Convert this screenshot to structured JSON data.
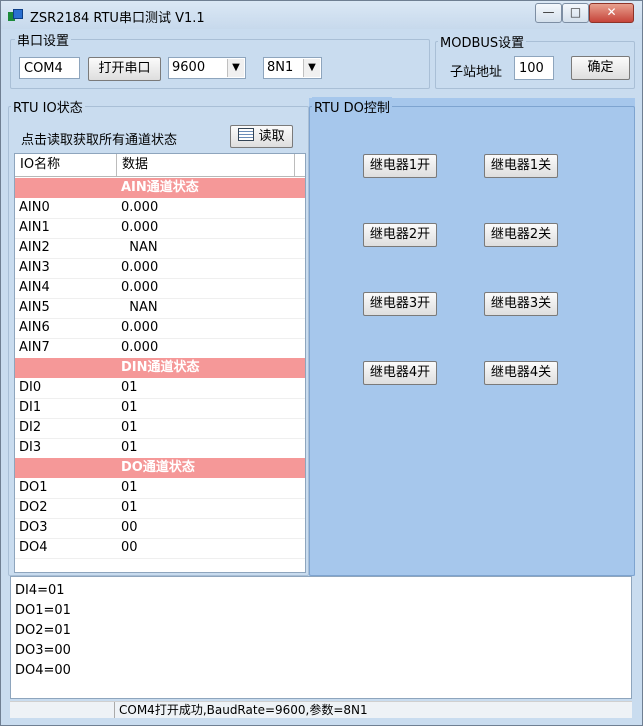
{
  "window": {
    "title": "ZSR2184 RTU串口测试 V1.1",
    "min_label": "—",
    "max_label": "□",
    "close_label": "✕"
  },
  "serial": {
    "group_title": "串口设置",
    "port": "COM4",
    "open_label": "打开串口",
    "baud": "9600",
    "param": "8N1"
  },
  "modbus": {
    "group_title": "MODBUS设置",
    "addr_label": "子站地址",
    "addr_value": "100",
    "confirm_label": "确定"
  },
  "io": {
    "group_title": "RTU IO状态",
    "hint": "点击读取获取所有通道状态",
    "read_label": "读取",
    "col_name": "IO名称",
    "col_data": "数据",
    "rows": [
      {
        "name": "",
        "data": "AIN通道状态",
        "section": true
      },
      {
        "name": "AIN0",
        "data": "0.000"
      },
      {
        "name": "AIN1",
        "data": "0.000"
      },
      {
        "name": "AIN2",
        "data": "  NAN"
      },
      {
        "name": "AIN3",
        "data": "0.000"
      },
      {
        "name": "AIN4",
        "data": "0.000"
      },
      {
        "name": "AIN5",
        "data": "  NAN"
      },
      {
        "name": "AIN6",
        "data": "0.000"
      },
      {
        "name": "AIN7",
        "data": "0.000"
      },
      {
        "name": "",
        "data": "DIN通道状态",
        "section": true
      },
      {
        "name": "DI0",
        "data": "01"
      },
      {
        "name": "DI1",
        "data": "01"
      },
      {
        "name": "DI2",
        "data": "01"
      },
      {
        "name": "DI3",
        "data": "01"
      },
      {
        "name": "",
        "data": "DO通道状态",
        "section": true
      },
      {
        "name": "DO1",
        "data": "01"
      },
      {
        "name": "DO2",
        "data": "01"
      },
      {
        "name": "DO3",
        "data": "00"
      },
      {
        "name": "DO4",
        "data": "00"
      }
    ]
  },
  "do_control": {
    "group_title": "RTU DO控制",
    "relays": [
      {
        "on": "继电器1开",
        "off": "继电器1关"
      },
      {
        "on": "继电器2开",
        "off": "继电器2关"
      },
      {
        "on": "继电器3开",
        "off": "继电器3关"
      },
      {
        "on": "继电器4开",
        "off": "继电器4关"
      }
    ]
  },
  "log": {
    "lines": [
      "DI4=01",
      "DO1=01",
      "DO2=01",
      "DO3=00",
      "DO4=00"
    ]
  },
  "status": {
    "text": "COM4打开成功,BaudRate=9600,参数=8N1"
  },
  "colors": {
    "section_bg": "#f59898",
    "panel_bg": "#c9dcef",
    "do_panel_bg": "#a6c7ec"
  }
}
